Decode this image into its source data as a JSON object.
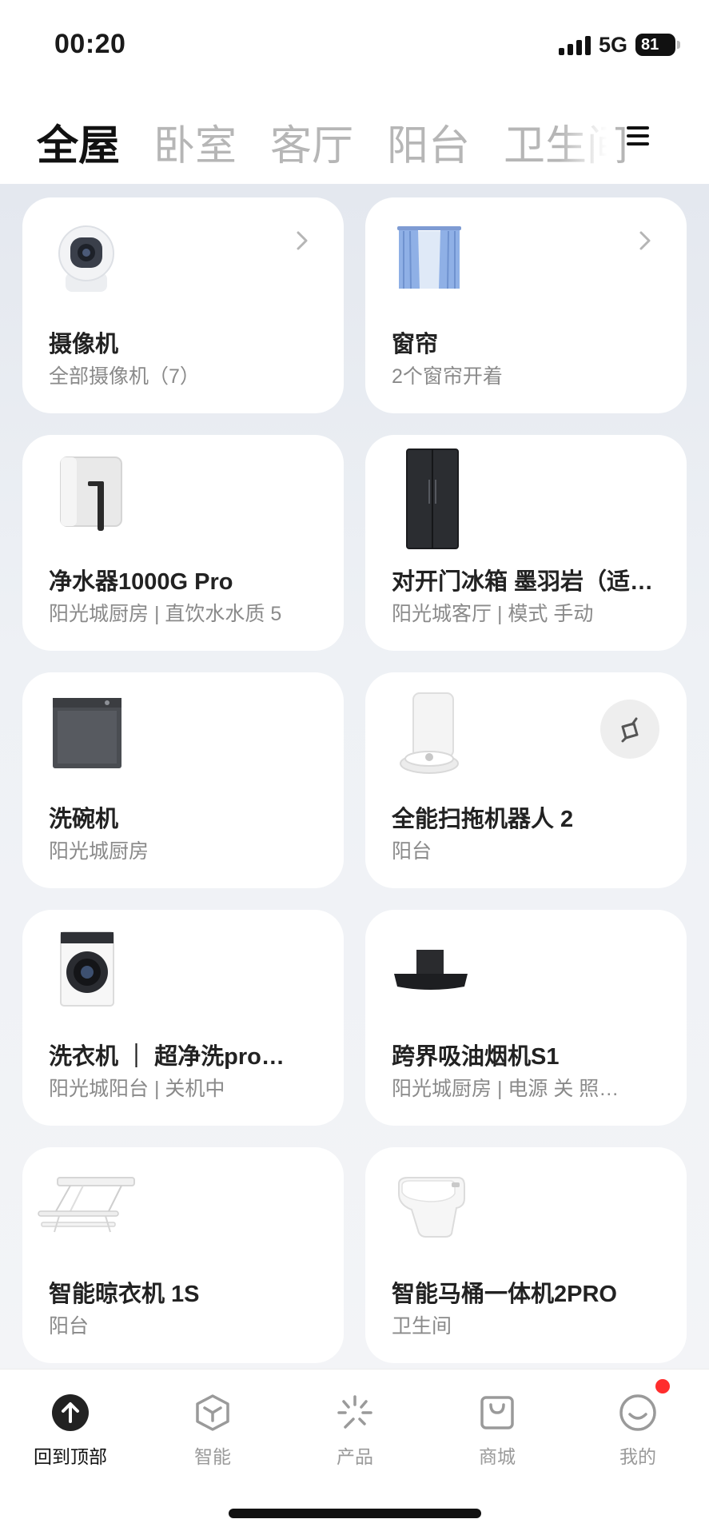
{
  "status_bar": {
    "time": "00:20",
    "network": "5G",
    "battery": "81"
  },
  "tabs": [
    "全屋",
    "卧室",
    "客厅",
    "阳台",
    "卫生间"
  ],
  "devices": [
    {
      "name": "摄像机",
      "sub": "全部摄像机（7）",
      "icon": "camera-icon"
    },
    {
      "name": "窗帘",
      "sub": "2个窗帘开着",
      "icon": "curtain-icon"
    },
    {
      "name": "净水器1000G Pro",
      "sub": "阳光城厨房 | 直饮水水质 5",
      "icon": "water-purifier-icon"
    },
    {
      "name": "对开门冰箱 墨羽岩（适…",
      "sub": "阳光城客厅 | 模式 手动",
      "icon": "refrigerator-icon"
    },
    {
      "name": "洗碗机",
      "sub": "阳光城厨房",
      "icon": "dishwasher-icon"
    },
    {
      "name": "全能扫拖机器人 2",
      "sub": "阳台",
      "icon": "robot-vacuum-icon"
    },
    {
      "name": "洗衣机 ｜ 超净洗pro…",
      "sub": "阳光城阳台 | 关机中",
      "icon": "washing-machine-icon"
    },
    {
      "name": "跨界吸油烟机S1",
      "sub": "阳光城厨房 | 电源 关 照…",
      "icon": "range-hood-icon"
    },
    {
      "name": "智能晾衣机 1S",
      "sub": "阳台",
      "icon": "clothes-rack-icon"
    },
    {
      "name": "智能马桶一体机2PRO",
      "sub": "卫生间",
      "icon": "smart-toilet-icon"
    }
  ],
  "bottom_nav": [
    {
      "label": "回到顶部",
      "icon": "arrow-up-icon"
    },
    {
      "label": "智能",
      "icon": "smart-cube-icon"
    },
    {
      "label": "产品",
      "icon": "sparkle-icon"
    },
    {
      "label": "商城",
      "icon": "shopping-bag-icon"
    },
    {
      "label": "我的",
      "icon": "smiley-icon"
    }
  ]
}
